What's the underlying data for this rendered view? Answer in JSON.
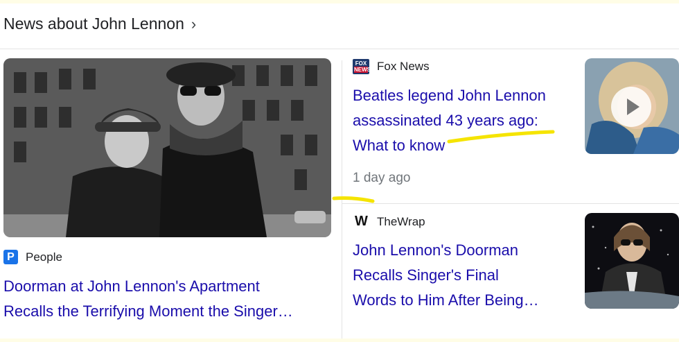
{
  "header": {
    "title": "News about John Lennon",
    "chevron": "›"
  },
  "big_story": {
    "source": "People",
    "source_logo_letter": "P",
    "title_line1": "Doorman at John Lennon's Apartment",
    "title_line2": "Recalls the Terrifying Moment the Singer…",
    "image_icon": "news-photo"
  },
  "stories": [
    {
      "source": "Fox News",
      "logo_top": "FOX",
      "logo_bottom": "NEWS",
      "title_line1": "Beatles legend John Lennon",
      "title_line2": "assassinated 43 years ago:",
      "title_line3": "What to know",
      "time": "1 day ago",
      "thumb_icon": "video-play-icon"
    },
    {
      "source": "TheWrap",
      "logo_letter": "W",
      "title_line1": "John Lennon's Doorman",
      "title_line2": "Recalls Singer's Final",
      "title_line3": "Words to Him After Being…"
    }
  ],
  "colors": {
    "link": "#1a0dab",
    "highlight": "#f5e400",
    "page_bg": "#fffde6"
  }
}
